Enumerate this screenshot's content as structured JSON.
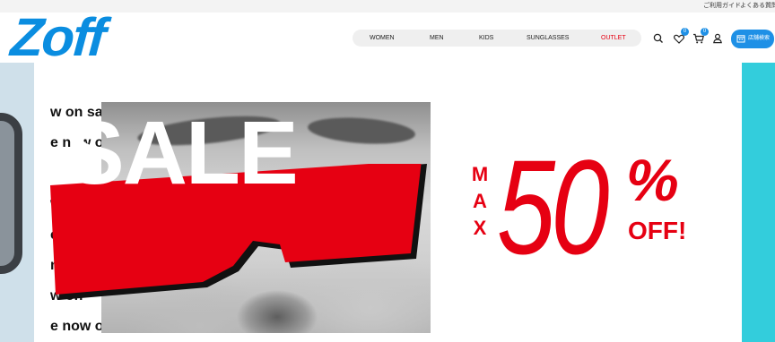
{
  "utility_links": [
    "ご利用ガイド",
    "よくある質問"
  ],
  "brand": {
    "logo_text": "Zoff",
    "color": "#0a8de0"
  },
  "nav": {
    "items": [
      "WOMEN",
      "MEN",
      "KIDS",
      "SUNGLASSES",
      "OUTLET"
    ],
    "outlet_color": "#e60012"
  },
  "header_icons": {
    "search": "search-icon",
    "favorites": {
      "icon": "heart-icon",
      "count": "0"
    },
    "cart": {
      "icon": "cart-icon",
      "count": "0"
    },
    "account": "user-icon"
  },
  "store_button": {
    "label": "店舗検索",
    "icon": "calendar-icon",
    "color": "#1e90e6"
  },
  "hero": {
    "scroll_lines": [
      "w on sale",
      "e now on",
      "w",
      "e n",
      "now",
      "w on",
      "e now on s"
    ],
    "sale_word": "SALE",
    "max_letters": [
      "M",
      "A",
      "X"
    ],
    "discount_number": "50",
    "percent_sign": "%",
    "off_text": "OFF!",
    "accent_color": "#e60012"
  }
}
